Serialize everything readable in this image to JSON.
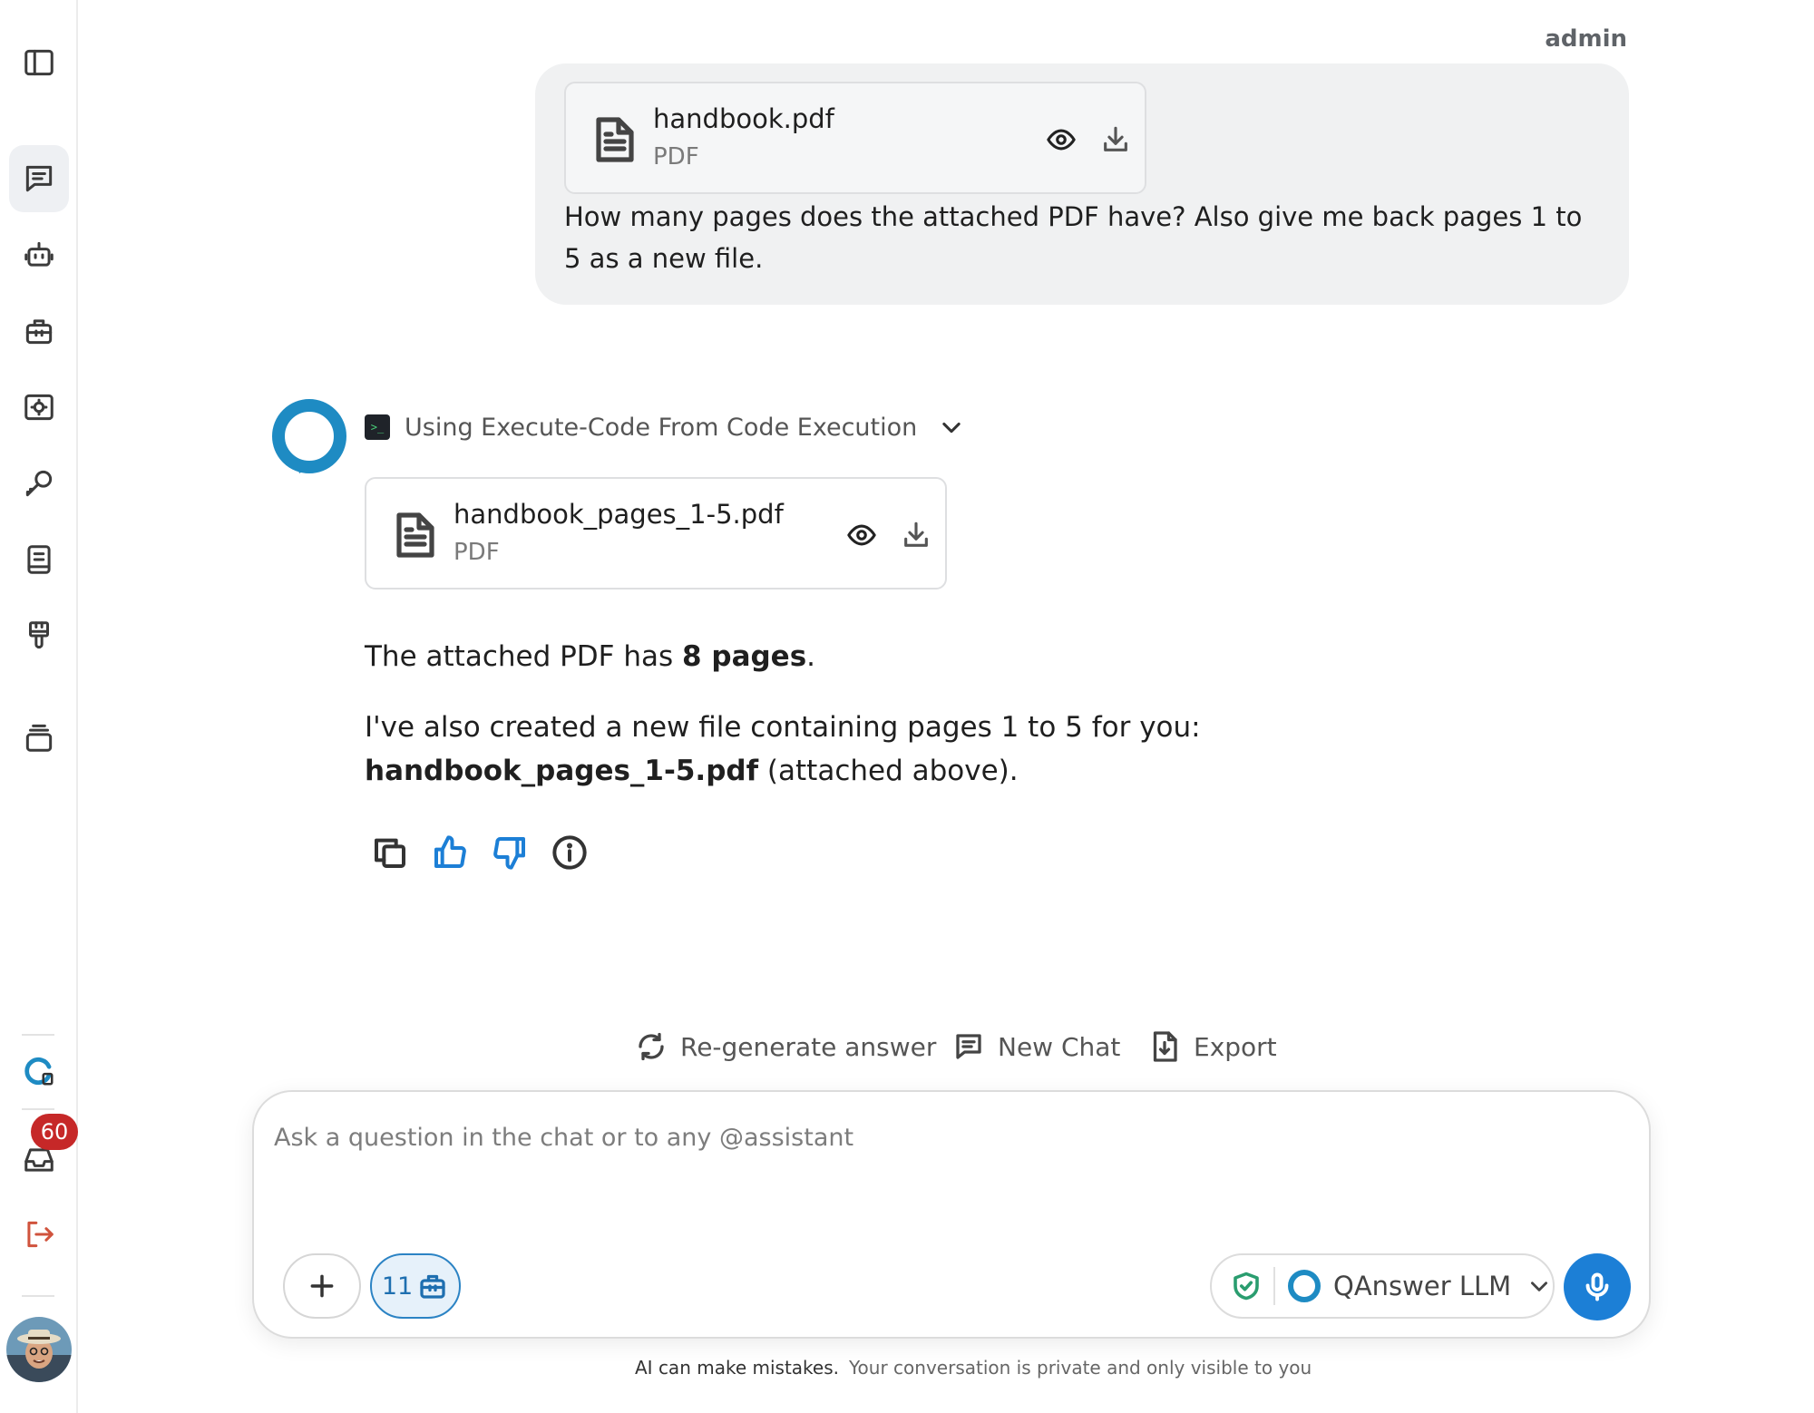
{
  "user": {
    "name": "admin",
    "attachment": {
      "name": "handbook.pdf",
      "type": "PDF"
    },
    "message": "How many pages does the attached PDF have? Also give me back pages 1 to 5 as a new file."
  },
  "assistant": {
    "tool_status": "Using Execute-Code From Code Execution",
    "attachment": {
      "name": "handbook_pages_1-5.pdf",
      "type": "PDF"
    },
    "answer": {
      "p1_prefix": "The attached PDF has ",
      "p1_bold": "8 pages",
      "p1_suffix": ".",
      "p2_prefix": "I've also created a new file containing pages 1 to 5 for you: ",
      "p2_bold": "handbook_pages_1-5.pdf",
      "p2_suffix": " (attached above)."
    }
  },
  "actions": {
    "regenerate": "Re-generate answer",
    "new_chat": "New Chat",
    "export": "Export"
  },
  "composer": {
    "placeholder": "Ask a question in the chat or to any @assistant",
    "value": "",
    "kit_count": "11",
    "model": "QAnswer LLM"
  },
  "sidebar": {
    "notifications_count": "60"
  },
  "footer": {
    "disclaimer": "AI can make mistakes.",
    "privacy": "Your conversation is private and only visible to you"
  },
  "colors": {
    "accent": "#1c7fd6",
    "brand_logo": "#1e8bc3",
    "badge": "#c62828",
    "bubble": "#f0f1f2",
    "shield": "#2a9d6f"
  },
  "icons": {
    "sidebar": [
      "sidebar-toggle-icon",
      "chat-icon",
      "bot-icon",
      "toolkit-icon",
      "settings-panel-icon",
      "key-icon",
      "book-icon",
      "brush-icon",
      "layers-icon",
      "qanswer-admin-icon",
      "inbox-icon",
      "logout-icon"
    ]
  }
}
